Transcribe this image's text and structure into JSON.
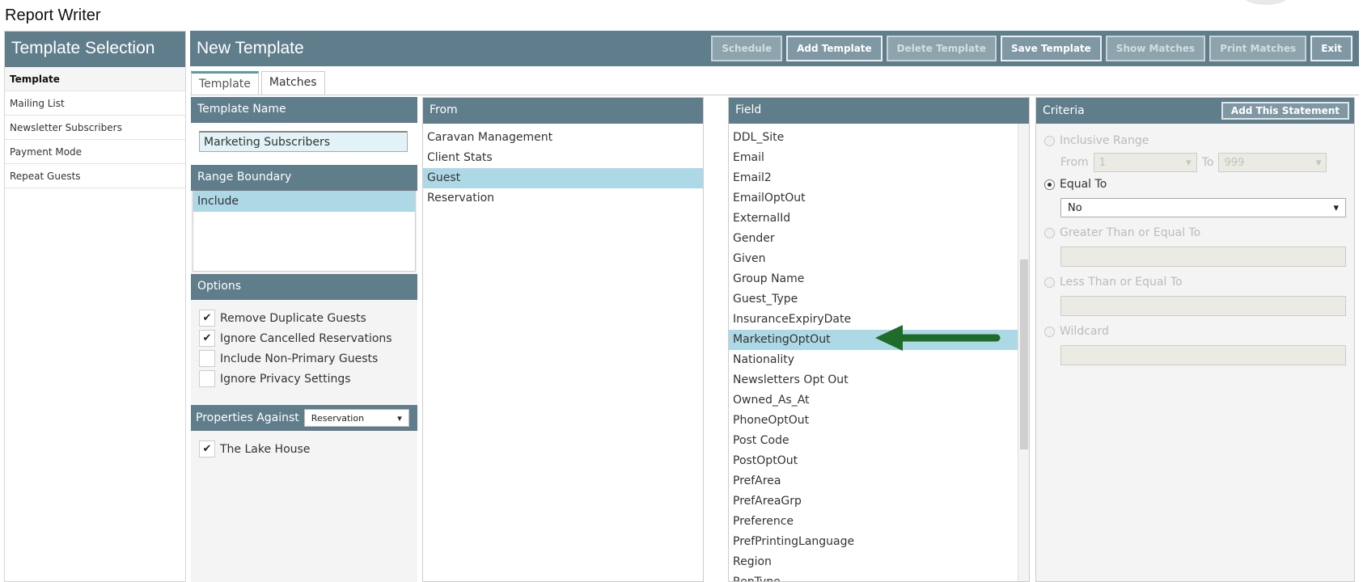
{
  "app": {
    "title": "Report Writer"
  },
  "sidebar": {
    "header": "Template Selection",
    "items": [
      {
        "label": "Template"
      },
      {
        "label": "Mailing List"
      },
      {
        "label": "Newsletter Subscribers"
      },
      {
        "label": "Payment Mode"
      },
      {
        "label": "Repeat Guests"
      }
    ]
  },
  "header": {
    "title": "New Template",
    "buttons": {
      "schedule": "Schedule",
      "add_template": "Add Template",
      "delete_template": "Delete Template",
      "save_template": "Save Template",
      "show_matches": "Show Matches",
      "print_matches": "Print Matches",
      "exit": "Exit"
    }
  },
  "tabs": {
    "template": "Template",
    "matches": "Matches"
  },
  "template_panel": {
    "name_header": "Template Name",
    "name_value": "Marketing Subscribers",
    "range_header": "Range Boundary",
    "range_items": [
      "Include"
    ],
    "options_header": "Options",
    "options": [
      {
        "label": "Remove Duplicate Guests",
        "checked": "✔"
      },
      {
        "label": "Ignore Cancelled Reservations",
        "checked": "✔"
      },
      {
        "label": "Include Non-Primary Guests",
        "checked": ""
      },
      {
        "label": "Ignore Privacy Settings",
        "checked": ""
      }
    ],
    "properties_label": "Properties Against",
    "properties_selected": "Reservation",
    "properties": [
      {
        "label": "The Lake House",
        "checked": "✔"
      }
    ]
  },
  "from_panel": {
    "header": "From",
    "items": [
      "Caravan Management",
      "Client Stats",
      "Guest",
      "Reservation"
    ],
    "selected": "Guest"
  },
  "field_panel": {
    "header": "Field",
    "items": [
      "DDL_Site",
      "Email",
      "Email2",
      "EmailOptOut",
      "ExternalId",
      "Gender",
      "Given",
      "Group Name",
      "Guest_Type",
      "InsuranceExpiryDate",
      "MarketingOptOut",
      "Nationality",
      "Newsletters Opt Out",
      "Owned_As_At",
      "PhoneOptOut",
      "Post Code",
      "PostOptOut",
      "PrefArea",
      "PrefAreaGrp",
      "Preference",
      "PrefPrintingLanguage",
      "Region",
      "RepType"
    ],
    "selected": "MarketingOptOut"
  },
  "criteria_panel": {
    "header": "Criteria",
    "add_button": "Add This Statement",
    "inclusive_range": "Inclusive Range",
    "from_label": "From",
    "from_value": "1",
    "to_label": "To",
    "to_value": "999",
    "equal_to": "Equal To",
    "equal_value": "No",
    "greater_than": "Greater Than or Equal To",
    "less_than": "Less Than or Equal To",
    "wildcard": "Wildcard"
  },
  "colors": {
    "header_bg": "#607d8b",
    "selection": "#add8e6",
    "arrow": "#1e6b2a"
  }
}
